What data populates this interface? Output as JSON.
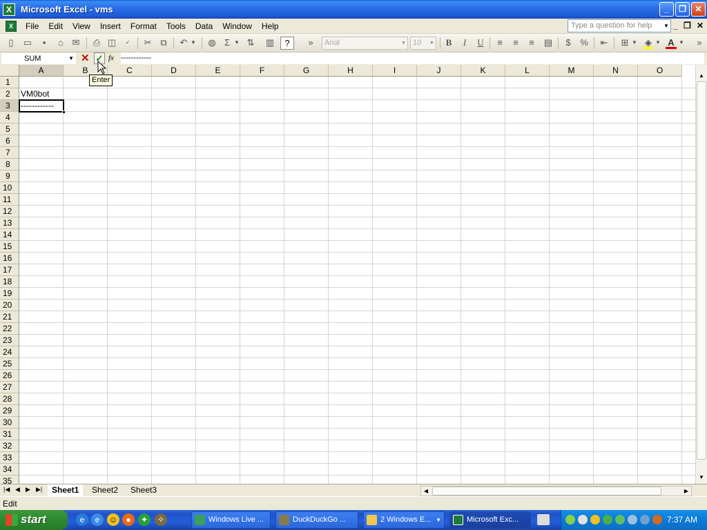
{
  "window": {
    "title": "Microsoft Excel - vms",
    "app_icon": "excel-icon",
    "controls": [
      "minimize",
      "restore",
      "close"
    ]
  },
  "menubar": {
    "items": [
      "File",
      "Edit",
      "View",
      "Insert",
      "Format",
      "Tools",
      "Data",
      "Window",
      "Help"
    ],
    "help_placeholder": "Type a question for help"
  },
  "toolbar": {
    "font": "Arial",
    "font_size": "10",
    "icons": [
      "new-icon",
      "open-icon",
      "save-icon",
      "permission-icon",
      "email-icon",
      "print-icon",
      "print-preview-icon",
      "spelling-icon",
      "cut-icon",
      "copy-icon",
      "undo-icon",
      "hyperlink-icon",
      "autosum-icon",
      "sort-icon",
      "chart-icon",
      "help-icon",
      "bold-icon",
      "italic-icon",
      "underline-icon",
      "align-left-icon",
      "align-center-icon",
      "align-right-icon",
      "merge-icon",
      "currency-icon",
      "percent-icon",
      "indent-icon",
      "borders-icon",
      "fill-color-icon",
      "font-color-icon"
    ],
    "bold": "B",
    "italic": "I",
    "underline": "U",
    "autosum": "Σ"
  },
  "formula_bar": {
    "name_box": "SUM",
    "fx": "fx",
    "content": "------------",
    "tooltip": "Enter"
  },
  "grid": {
    "columns": [
      "A",
      "B",
      "C",
      "D",
      "E",
      "F",
      "G",
      "H",
      "I",
      "J",
      "K",
      "L",
      "M",
      "N",
      "O"
    ],
    "rows": [
      "1",
      "2",
      "3",
      "4",
      "5",
      "6",
      "7",
      "8",
      "9",
      "10",
      "11",
      "12",
      "13",
      "14",
      "15",
      "16",
      "17",
      "18",
      "19",
      "20",
      "21",
      "22",
      "23",
      "24",
      "25",
      "26",
      "27",
      "28",
      "29",
      "30",
      "31",
      "32",
      "33",
      "34",
      "35"
    ],
    "active_cell": "A3",
    "cells": {
      "A2": "VM0bot",
      "A3": "------------"
    }
  },
  "sheets": {
    "tabs": [
      "Sheet1",
      "Sheet2",
      "Sheet3"
    ],
    "active": "Sheet1"
  },
  "status": {
    "mode": "Edit"
  },
  "taskbar": {
    "start": "start",
    "tasks": [
      "Windows Live ...",
      "DuckDuckGo ...",
      "2 Windows E...",
      "Microsoft Exc..."
    ],
    "active_task": "Microsoft Exc...",
    "clock": "7:37 AM"
  },
  "colors": {
    "title_bar": "#2a6fe8",
    "accent_green": "#1e7b3a",
    "font_color_swatch": "#e00000",
    "fill_color_swatch": "#ffff00"
  }
}
